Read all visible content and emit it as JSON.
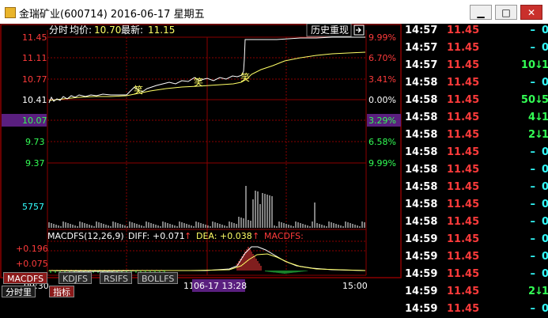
{
  "window": {
    "title": "金瑞矿业(600714) 2016-06-17 星期五",
    "minimize": "▁",
    "maximize": "□",
    "close": "✕"
  },
  "chart_header": {
    "mode": "分时",
    "avg_label": "均价:",
    "avg_value": "10.70",
    "latest_label": "最新:",
    "latest_value": "11.15",
    "history_button": "历史重现",
    "history_icon": "exit-arrow-icon"
  },
  "price_axis_labels": [
    "11.45",
    "11.11",
    "10.77",
    "10.41",
    "10.07",
    "9.73",
    "9.37"
  ],
  "pct_axis_labels": [
    "9.99%",
    "6.70%",
    "3.41%",
    "0.00%",
    "3.29%",
    "6.58%",
    "9.99%"
  ],
  "volume_label": "5757",
  "macd": {
    "title": "MACDFS(12,26,9)",
    "diff_label": "DIFF:",
    "diff_value": "+0.071",
    "dea_label": "DEA:",
    "dea_value": "+0.038",
    "macdfs_label": "MACDFS:",
    "axis_top": "+0.196",
    "axis_mid": "+0.075"
  },
  "time_axis": {
    "start": "09:30",
    "mid_fragment": "11",
    "cursor": "06-17 13:28",
    "end": "15:00"
  },
  "markers": [
    "笑",
    "笑",
    "笑"
  ],
  "tabs": [
    "MACDFS",
    "KDJFS",
    "RSIFS",
    "BOLLFS"
  ],
  "bottom_tabs": [
    "分时里",
    "指标"
  ],
  "colors": {
    "up": "#ff3b3b",
    "down": "#33ff55",
    "flat": "#33ffff",
    "grid": "#8b0000",
    "price_line": "#ffffff",
    "avg_line": "#ffff66",
    "cursor_bg": "#5a1f7f"
  },
  "ticks": [
    {
      "time": "14:57",
      "price": "11.45",
      "vol": "–",
      "act": "0"
    },
    {
      "time": "14:57",
      "price": "11.45",
      "vol": "–",
      "act": "0"
    },
    {
      "time": "14:57",
      "price": "11.45",
      "vol": "10",
      "arrow": "down-arrow-icon",
      "act": "1"
    },
    {
      "time": "14:58",
      "price": "11.45",
      "vol": "–",
      "act": "0"
    },
    {
      "time": "14:58",
      "price": "11.45",
      "vol": "50",
      "arrow": "down-arrow-icon",
      "act": "5"
    },
    {
      "time": "14:58",
      "price": "11.45",
      "vol": "4",
      "arrow": "down-arrow-icon",
      "act": "1"
    },
    {
      "time": "14:58",
      "price": "11.45",
      "vol": "2",
      "arrow": "down-arrow-icon",
      "act": "1"
    },
    {
      "time": "14:58",
      "price": "11.45",
      "vol": "–",
      "act": "0"
    },
    {
      "time": "14:58",
      "price": "11.45",
      "vol": "–",
      "act": "0"
    },
    {
      "time": "14:58",
      "price": "11.45",
      "vol": "–",
      "act": "0"
    },
    {
      "time": "14:58",
      "price": "11.45",
      "vol": "–",
      "act": "0"
    },
    {
      "time": "14:58",
      "price": "11.45",
      "vol": "–",
      "act": "0"
    },
    {
      "time": "14:59",
      "price": "11.45",
      "vol": "–",
      "act": "0"
    },
    {
      "time": "14:59",
      "price": "11.45",
      "vol": "–",
      "act": "0"
    },
    {
      "time": "14:59",
      "price": "11.45",
      "vol": "–",
      "act": "0"
    },
    {
      "time": "14:59",
      "price": "11.45",
      "vol": "2",
      "arrow": "down-arrow-icon",
      "act": "1"
    },
    {
      "time": "14:59",
      "price": "11.45",
      "vol": "–",
      "act": "0"
    }
  ]
}
